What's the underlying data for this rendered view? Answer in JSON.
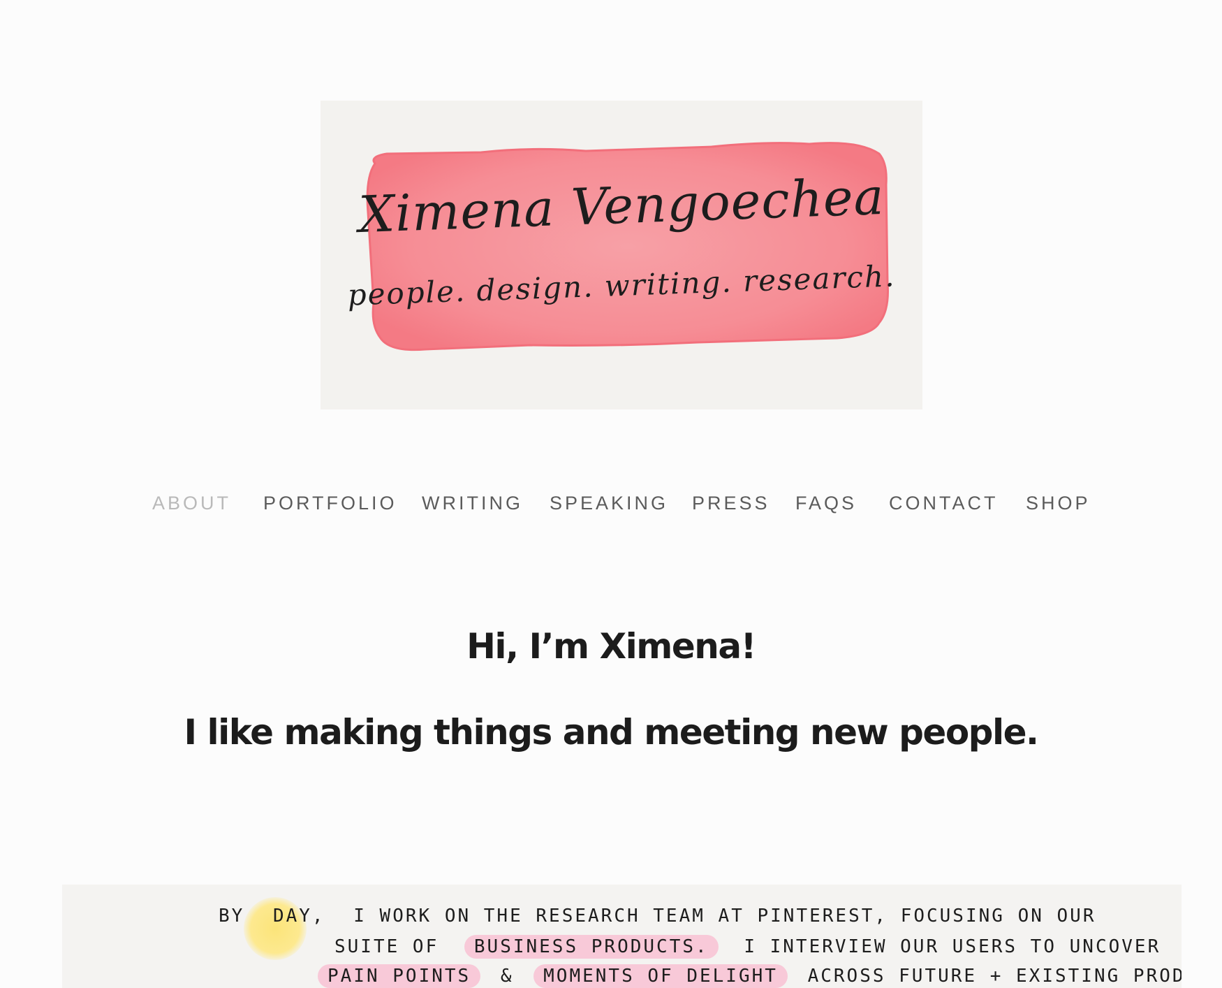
{
  "banner": {
    "name": "Ximena Vengoechea",
    "tagline": "people. design. writing. research.",
    "colors": {
      "background": "#f3f2ef",
      "brush": "#f7878f"
    }
  },
  "nav": {
    "items": [
      {
        "label": "ABOUT",
        "active": true
      },
      {
        "label": "PORTFOLIO",
        "active": false
      },
      {
        "label": "WRITING",
        "active": false
      },
      {
        "label": "SPEAKING",
        "active": false
      },
      {
        "label": "PRESS",
        "active": false
      },
      {
        "label": "FAQS",
        "active": false
      },
      {
        "label": "CONTACT",
        "active": false
      },
      {
        "label": "SHOP",
        "active": false
      }
    ]
  },
  "intro": {
    "greeting": "Hi, I’m Ximena!",
    "subtitle": "I like making things and meeting new people."
  },
  "bio": {
    "line1_a": "BY",
    "line1_day": "DAY,",
    "line1_b": "I WORK ON THE RESEARCH TEAM AT PINTEREST, FOCUSING ON OUR",
    "line2_a": "SUITE OF",
    "line2_hl": "BUSINESS PRODUCTS.",
    "line2_b": "I INTERVIEW OUR USERS TO UNCOVER",
    "line3_hl1": "PAIN POINTS",
    "line3_amp": "&",
    "line3_hl2": "MOMENTS OF DELIGHT",
    "line3_b": "ACROSS FUTURE + EXISTING PRODUCT EXPERIENCES."
  }
}
